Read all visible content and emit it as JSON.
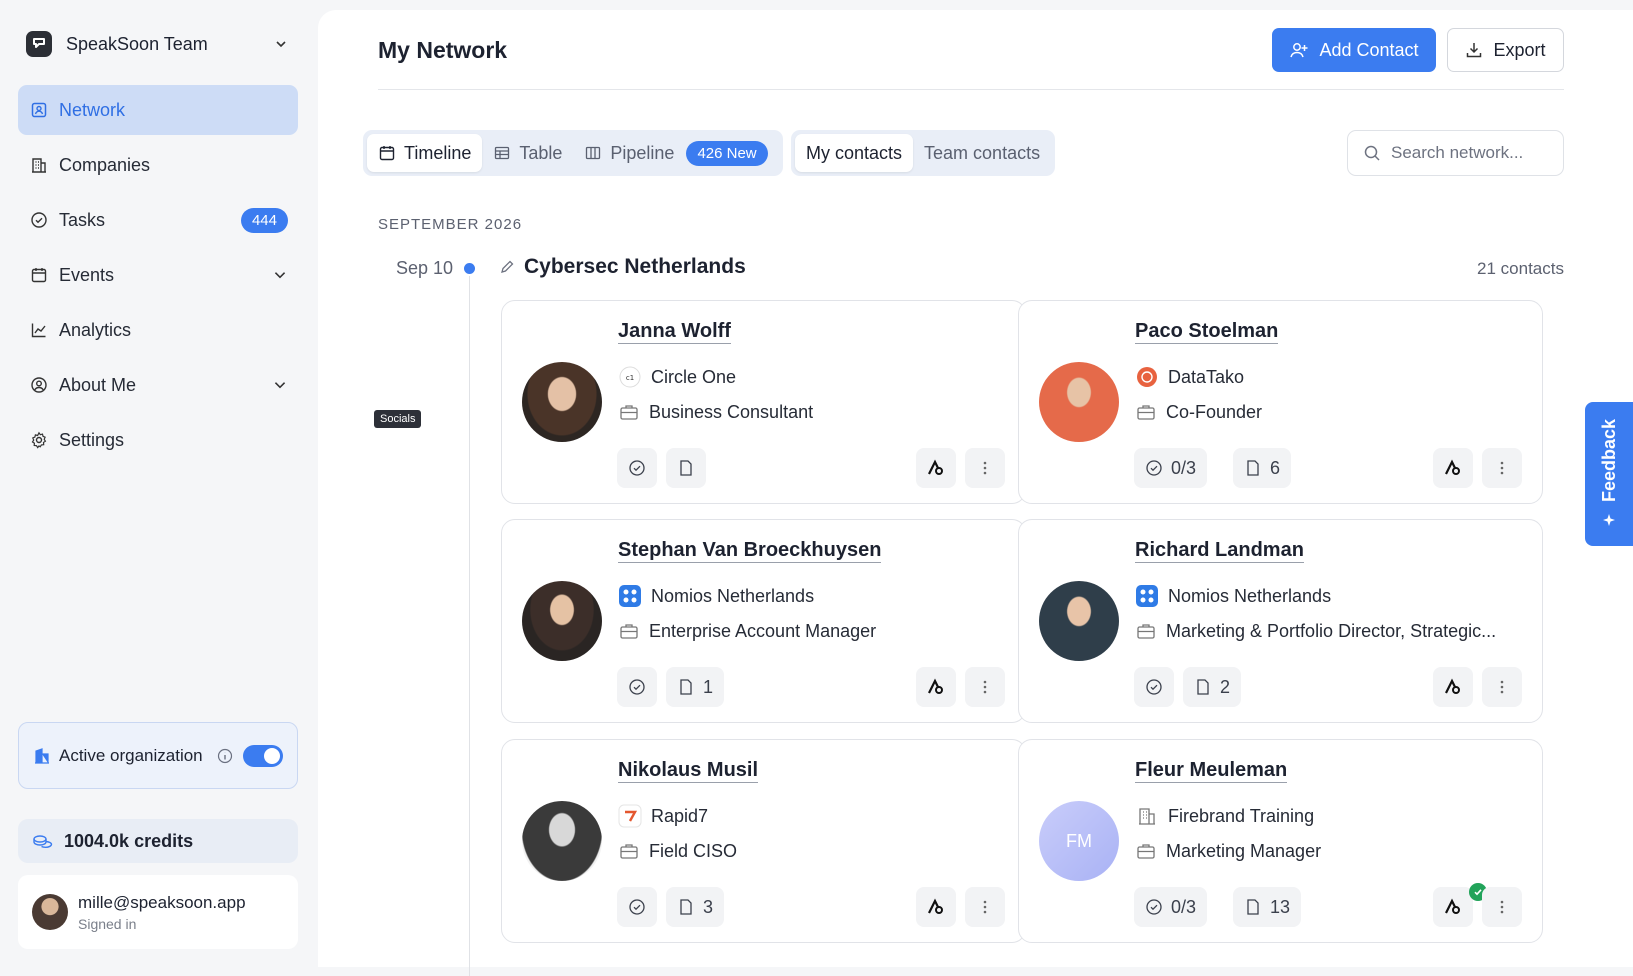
{
  "team": {
    "name": "SpeakSoon Team"
  },
  "nav": [
    {
      "label": "Network",
      "icon": "network-icon",
      "active": true
    },
    {
      "label": "Companies",
      "icon": "building-icon"
    },
    {
      "label": "Tasks",
      "icon": "check-circle-icon",
      "badge": "444"
    },
    {
      "label": "Events",
      "icon": "calendar-icon",
      "expandable": true
    },
    {
      "label": "Analytics",
      "icon": "chart-icon"
    },
    {
      "label": "About Me",
      "icon": "user-circle-icon",
      "expandable": true
    },
    {
      "label": "Settings",
      "icon": "gear-icon"
    }
  ],
  "org": {
    "label": "Active organization",
    "enabled": true
  },
  "credits": {
    "label": "1004.0k credits"
  },
  "user": {
    "email": "mille@speaksoon.app",
    "status": "Signed in"
  },
  "header": {
    "title": "My Network",
    "add_label": "Add Contact",
    "export_label": "Export"
  },
  "views": {
    "timeline": "Timeline",
    "table": "Table",
    "pipeline": "Pipeline",
    "pipeline_badge": "426 New"
  },
  "scope": {
    "mine": "My contacts",
    "team": "Team contacts"
  },
  "search": {
    "placeholder": "Search network..."
  },
  "timeline": {
    "month": "SEPTEMBER 2026",
    "date": "Sep 10",
    "event": "Cybersec Netherlands",
    "count": "21 contacts",
    "tooltip": "Socials"
  },
  "contacts": [
    {
      "name": "Janna Wolff",
      "company": "Circle One",
      "role": "Business Consultant",
      "tasks": "",
      "docs": "",
      "company_icon": "circle-one-logo"
    },
    {
      "name": "Paco Stoelman",
      "company": "DataTako",
      "role": "Co-Founder",
      "tasks": "0/3",
      "docs": "6",
      "company_icon": "datatako-logo"
    },
    {
      "name": "Stephan Van Broeckhuysen",
      "company": "Nomios Netherlands",
      "role": "Enterprise Account Manager",
      "tasks": "",
      "docs": "1",
      "company_icon": "nomios-logo"
    },
    {
      "name": "Richard Landman",
      "company": "Nomios Netherlands",
      "role": "Marketing & Portfolio Director, Strategic...",
      "tasks": "",
      "docs": "2",
      "company_icon": "nomios-logo"
    },
    {
      "name": "Nikolaus Musil",
      "company": "Rapid7",
      "role": "Field CISO",
      "tasks": "",
      "docs": "3",
      "company_icon": "rapid7-logo"
    },
    {
      "name": "Fleur Meuleman",
      "company": "Firebrand Training",
      "role": "Marketing Manager",
      "tasks": "0/3",
      "docs": "13",
      "company_icon": "building-icon",
      "initials": "FM",
      "verified": true
    }
  ],
  "feedback": {
    "label": "Feedback"
  },
  "colors": {
    "accent": "#3b7cf0",
    "nav_active_bg": "#cddcf6",
    "verified": "#22a35a"
  }
}
